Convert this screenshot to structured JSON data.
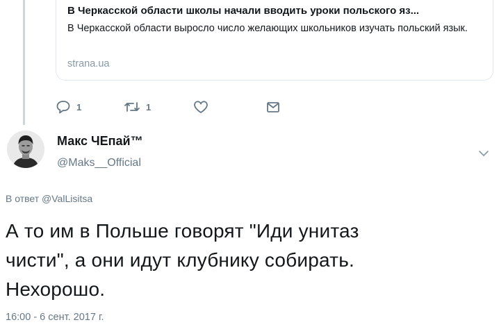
{
  "link_card": {
    "title": "В Черкасской области школы начали вводить уроки польского яз...",
    "description": "В Черкасской области выросло число желающих школьников изучать польский язык.",
    "domain": "strana.ua"
  },
  "previous_tweet_actions": {
    "reply_count": "1",
    "retweet_count": "1",
    "like_count": "",
    "icons": [
      "reply-icon",
      "retweet-icon",
      "like-icon",
      "message-icon"
    ]
  },
  "tweet": {
    "author_name": "Макс ЧЕпай™",
    "author_handle": "@Maks__Official",
    "reply_prefix": "В ответ",
    "reply_to_handle": "@ValLisitsa",
    "text": "А то им в Польше говорят \"Иди унитаз\nчисти\", а они идут клубнику собирать.\nНехорошо.",
    "timestamp": "16:00 - 6 сент. 2017 г."
  },
  "colors": {
    "text_primary": "#14171a",
    "text_secondary": "#657786",
    "border": "#e1e8ed",
    "thread_line": "#ccd6dd"
  }
}
